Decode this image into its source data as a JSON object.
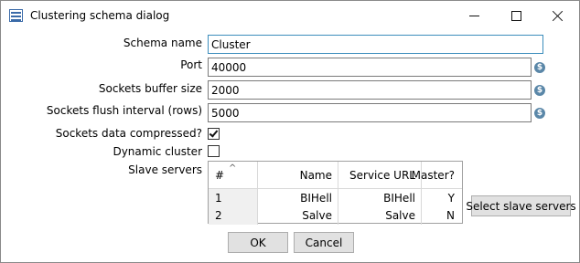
{
  "window": {
    "title": "Clustering schema dialog"
  },
  "form": {
    "schema_name": {
      "label": "Schema name",
      "value": "Cluster"
    },
    "port": {
      "label": "Port",
      "value": "40000"
    },
    "sockets_buffer_size": {
      "label": "Sockets buffer size",
      "value": "2000"
    },
    "sockets_flush_interval": {
      "label": "Sockets flush interval (rows)",
      "value": "5000"
    },
    "sockets_data_compressed": {
      "label": "Sockets data compressed?",
      "checked": true
    },
    "dynamic_cluster": {
      "label": "Dynamic cluster",
      "checked": false
    },
    "variable_icon_glyph": "$"
  },
  "slave_servers": {
    "label": "Slave servers",
    "columns": [
      "#",
      "Name",
      "Service URL",
      "Master?"
    ],
    "rows": [
      {
        "num": "1",
        "name": "BIHell",
        "url": "BIHell",
        "master": "Y"
      },
      {
        "num": "2",
        "name": "Salve",
        "url": "Salve",
        "master": "N"
      }
    ],
    "select_button": "Select slave servers"
  },
  "buttons": {
    "ok": "OK",
    "cancel": "Cancel"
  }
}
